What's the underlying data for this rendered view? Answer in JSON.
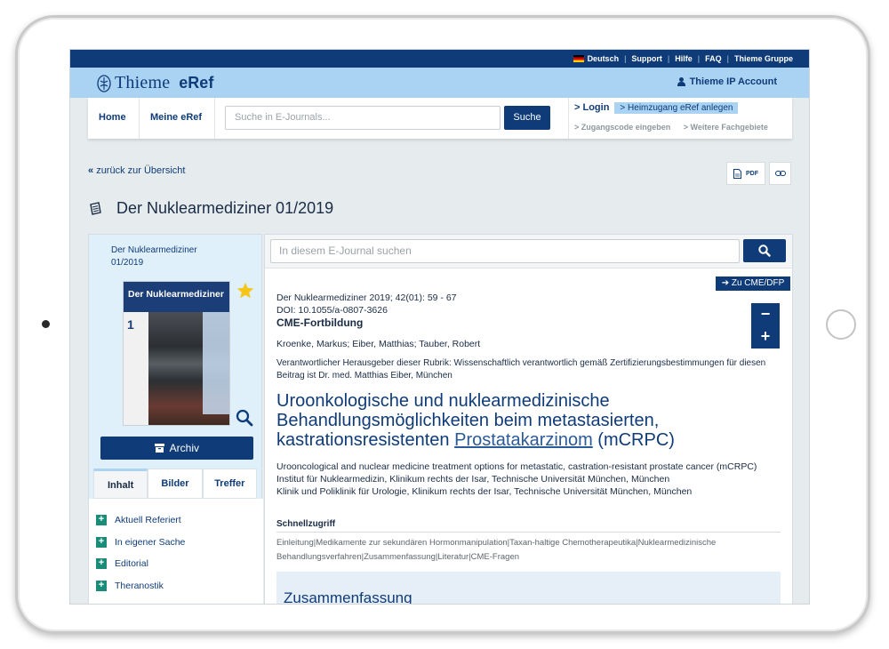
{
  "utility_bar": {
    "language": "Deutsch",
    "links": [
      "Support",
      "Hilfe",
      "FAQ",
      "Thieme Gruppe"
    ]
  },
  "brand": {
    "name": "Thieme",
    "product": "eRef",
    "account": "Thieme IP Account"
  },
  "nav": {
    "home": "Home",
    "meine_eref": "Meine eRef",
    "search_placeholder": "Suche in E-Journals...",
    "search_button": "Suche",
    "login": "> Login",
    "heimzugang": "> Heimzugang eRef anlegen",
    "zugangscode": "> Zugangscode eingeben",
    "fachgebiete": "> Weitere Fachgebiete"
  },
  "back_link": "zurück zur Übersicht",
  "actions": {
    "pdf": "PDF"
  },
  "journal_title": "Der Nuklearmediziner 01/2019",
  "sidebar": {
    "title": "Der Nuklearmediziner 01/2019",
    "cover_title": "Der Nuklearmediziner",
    "cover_issue": "1",
    "archiv": "Archiv",
    "tabs": [
      "Inhalt",
      "Bilder",
      "Treffer"
    ],
    "toc": [
      "Aktuell Referiert",
      "In eigener Sache",
      "Editorial",
      "Theranostik"
    ]
  },
  "main": {
    "search_placeholder": "In diesem E-Journal suchen",
    "cme_button": "Zu CME/DFP",
    "citation": "Der Nuklearmediziner 2019; 42(01): 59 - 67",
    "doi": "DOI: 10.1055/a-0807-3626",
    "category": "CME-Fortbildung",
    "authors": "Kroenke, Markus; Eiber, Matthias; Tauber, Robert",
    "editor_note": "Verantwortlicher Herausgeber dieser Rubrik: Wissenschaftlich verantwortlich gemäß Zertifizierungsbestimmungen für diesen Beitrag ist Dr. med. Matthias Eiber, München",
    "title_part1": "Uroonkologische und nuklearmedizinische Behandlungsmöglichkeiten beim metastasierten, kastrationsresistenten ",
    "title_link": "Prostatakarzinom",
    "title_part2": " (mCRPC)",
    "title_en": "Urooncological and nuclear medicine treatment options for metastatic, castration-resistant prostate cancer (mCRPC)",
    "affiliation1": "Institut für Nuklearmedizin, Klinikum rechts der Isar, Technische Universität München, München",
    "affiliation2": "Klinik und Poliklinik für Urologie, Klinikum rechts der Isar, Technische Universität München, München",
    "schnellzugriff": "Schnellzugriff",
    "quick_links": "Einleitung|Medikamente zur sekundären Hormonmanipulation|Taxan-haltige Chemotherapeutika|Nuklearmedizinische Behandlungsverfahren|Zusammenfassung|Literatur|CME-Fragen",
    "zusammenfassung": "Zusammenfassung"
  },
  "colors": {
    "navy": "#0f3c78",
    "light_blue": "#a9d2f3",
    "teal_plus": "#1a8c78",
    "star": "#f5c518"
  }
}
